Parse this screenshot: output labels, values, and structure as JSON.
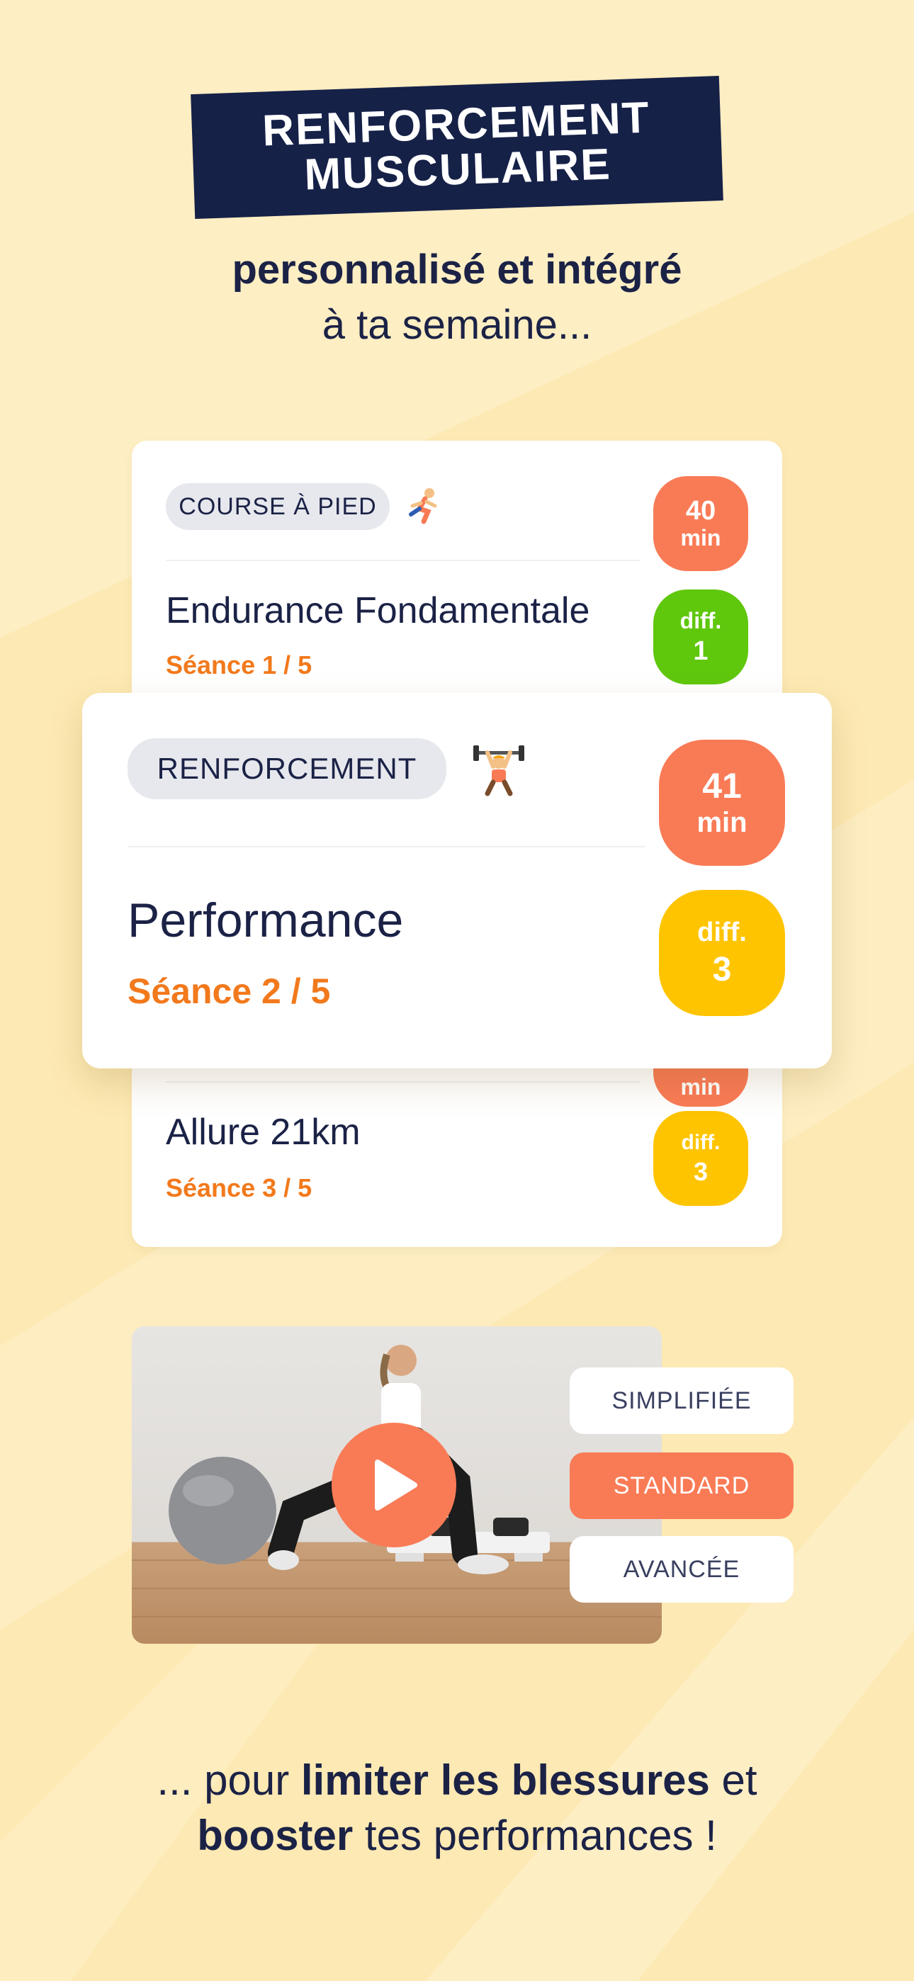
{
  "header": {
    "line1": "RENFORCEMENT",
    "line2": "MUSCULAIRE"
  },
  "subtitle": {
    "line1": "personnalisé et intégré",
    "line2": "à ta semaine..."
  },
  "sessions_back": [
    {
      "tag": "COURSE À PIED",
      "tag_icon": "runner-emoji",
      "title": "Endurance Fondamentale",
      "seance": "Séance 1 / 5",
      "duration_value": "40",
      "duration_unit": "min",
      "difficulty_label": "diff.",
      "difficulty_value": "1"
    },
    {
      "title": "Allure 21km",
      "seance": "Séance 3 / 5",
      "duration_unit": "min",
      "difficulty_label": "diff.",
      "difficulty_value": "3"
    }
  ],
  "session_front": {
    "tag": "RENFORCEMENT",
    "tag_icon": "weightlifter-emoji",
    "title": "Performance",
    "seance": "Séance 2 / 5",
    "duration_value": "41",
    "duration_unit": "min",
    "difficulty_label": "diff.",
    "difficulty_value": "3"
  },
  "video": {
    "play_icon": "play-icon",
    "levels": [
      "SIMPLIFIÉE",
      "STANDARD",
      "AVANCÉE"
    ],
    "selected_level": "STANDARD"
  },
  "bottom": {
    "part1": "... pour ",
    "bold1": "limiter les blessures",
    "part2": " et",
    "bold2": "booster",
    "part3": " tes performances !"
  },
  "colors": {
    "background": "#fde9b3",
    "navy": "#162148",
    "orange": "#f97b56",
    "green": "#5fc70c",
    "yellow": "#ffc400",
    "seance_orange": "#f2791c"
  }
}
